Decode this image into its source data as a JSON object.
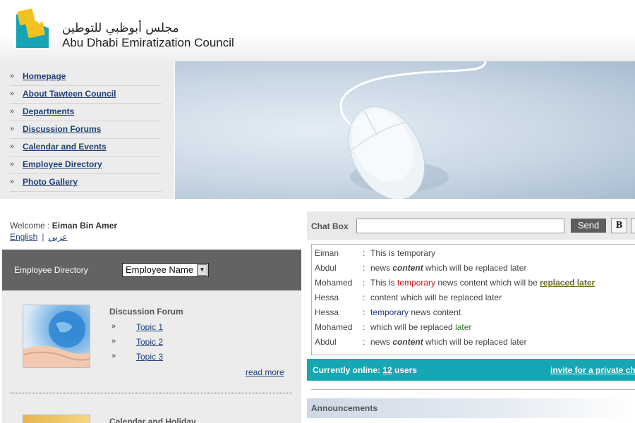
{
  "header": {
    "logo_arabic": "مجلس أبوظبي للتوطين",
    "logo_english": "Abu Dhabi Emiratization Council"
  },
  "nav": {
    "bullet": "»",
    "items": [
      {
        "label": "Homepage"
      },
      {
        "label": "About Tawteen Council"
      },
      {
        "label": "Departments"
      },
      {
        "label": "Discussion Forums"
      },
      {
        "label": "Calendar and Events"
      },
      {
        "label": "Employee Directory"
      },
      {
        "label": "Photo Gallery"
      }
    ]
  },
  "welcome": {
    "prefix": "Welcome : ",
    "user": "Eiman Bin Amer",
    "lang_english": "English",
    "lang_separator": "|",
    "lang_arabic": "عربي"
  },
  "employee_directory": {
    "label": "Employee Directory",
    "select_value": "Employee Name"
  },
  "forum": {
    "title": "Discussion Forum",
    "topics": [
      "Topic 1",
      "Topic 2",
      "Topic 3"
    ],
    "read_more": "read more"
  },
  "calendar": {
    "title": "Calendar and Holiday"
  },
  "chat": {
    "label": "Chat Box",
    "send": "Send",
    "bold": "B",
    "separator": ":",
    "messages": [
      {
        "who": "Eiman",
        "t1": "This is temporary"
      },
      {
        "who": "Abdul",
        "t1": "news ",
        "strong": "content",
        "t2": " which will be replaced later"
      },
      {
        "who": "Mohamed",
        "t1": "This is ",
        "red": "temporary",
        "t2": " news content which will be ",
        "olive": "replaced later"
      },
      {
        "who": "Hessa",
        "t1": "content which will be replaced later"
      },
      {
        "who": "Hessa",
        "navy": "temporary",
        "t2": " news content"
      },
      {
        "who": "Mohamed",
        "t1": "which will be replaced ",
        "green": "later"
      },
      {
        "who": "Abdul",
        "t1": "news ",
        "strong": "content",
        "t2": " which will be replaced later"
      }
    ]
  },
  "online": {
    "prefix": "Currently online: ",
    "count": "12",
    "suffix": " users",
    "invite": "invite for a private chat"
  },
  "announcements": {
    "label": "Announcements"
  },
  "colors": {
    "accent_teal": "#15a7b3",
    "link_blue": "#1f3f77",
    "bar_gray": "#636363"
  }
}
